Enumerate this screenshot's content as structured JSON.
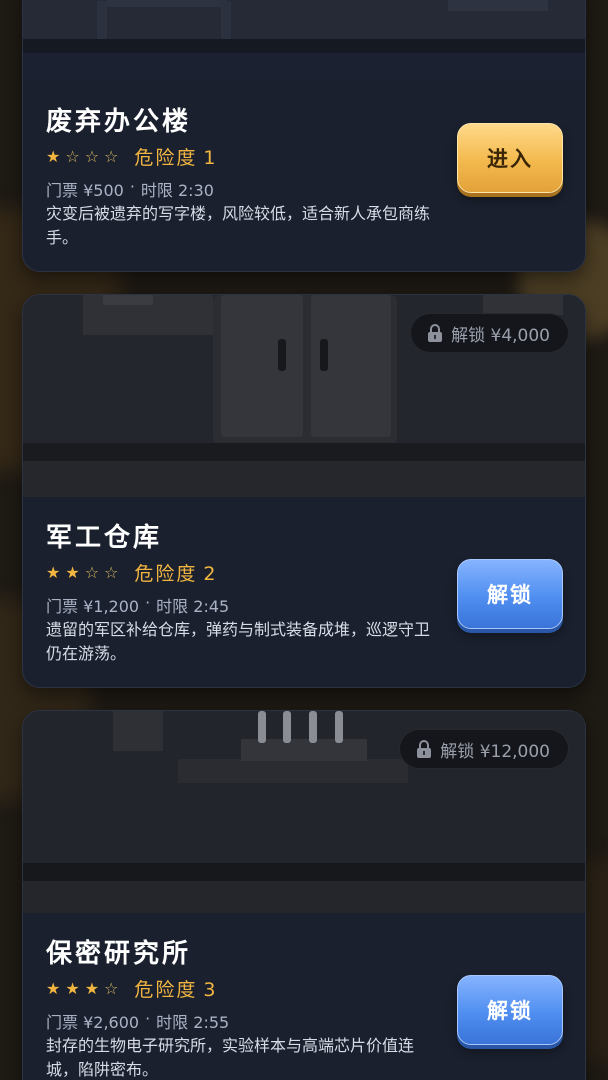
{
  "venues": [
    {
      "title": "废弃办公楼",
      "stars_filled": 1,
      "stars_total": 4,
      "danger_label": "危险度",
      "danger_level": "1",
      "ticket": "门票 ¥500",
      "separator": "·",
      "time_limit": "时限 2:30",
      "description": "灾变后被遗弃的写字楼，风险较低，适合新人承包商练手。",
      "action_label": "进入",
      "locked": false
    },
    {
      "title": "军工仓库",
      "stars_filled": 2,
      "stars_total": 4,
      "danger_label": "危险度",
      "danger_level": "2",
      "ticket": "门票 ¥1,200",
      "separator": "·",
      "time_limit": "时限 2:45",
      "description": "遗留的军区补给仓库，弹药与制式装备成堆，巡逻守卫仍在游荡。",
      "action_label": "解锁",
      "lock_price": "解锁 ¥4,000",
      "locked": true
    },
    {
      "title": "保密研究所",
      "stars_filled": 3,
      "stars_total": 4,
      "danger_label": "危险度",
      "danger_level": "3",
      "ticket": "门票 ¥2,600",
      "separator": "·",
      "time_limit": "时限 2:55",
      "description": "封存的生物电子研究所，实验样本与高端芯片价值连城，陷阱密布。",
      "action_label": "解锁",
      "lock_price": "解锁 ¥12,000",
      "locked": true
    }
  ],
  "colors": {
    "accent_gold": "#f2b640",
    "button_enter": "#f3b94d",
    "button_unlock": "#4f8ef0",
    "card_bg": "#1a202e"
  },
  "icons": {
    "star_filled": "★",
    "star_empty": "☆",
    "lock": "lock-icon"
  }
}
